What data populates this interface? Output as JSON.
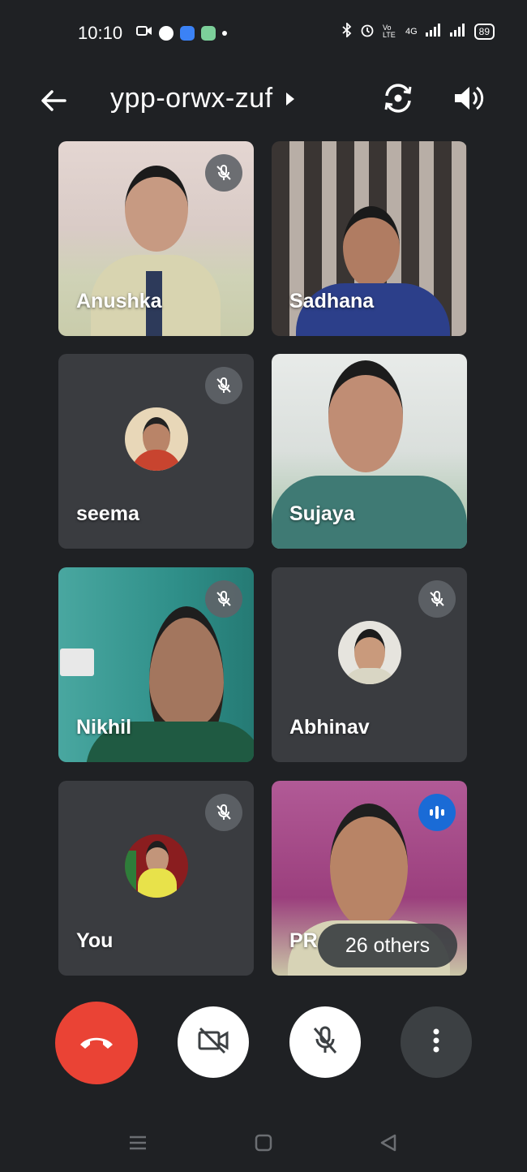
{
  "status_bar": {
    "time": "10:10",
    "network_label": "4G",
    "volte_label": "Vo LTE",
    "battery": "89",
    "left_icons": [
      "video-icon",
      "messenger-icon",
      "app-icon",
      "gallery-icon",
      "dot-icon"
    ],
    "right_icons": [
      "bluetooth-icon",
      "alarm-icon",
      "volte-icon",
      "signal-icon",
      "signal-icon",
      "battery-icon"
    ]
  },
  "top_bar": {
    "meeting_code": "ypp-orwx-zuf",
    "icons": [
      "back-arrow-icon",
      "caret-right-icon",
      "switch-camera-icon",
      "speaker-icon"
    ]
  },
  "participants": [
    {
      "name": "Anushka",
      "muted": true,
      "video": true
    },
    {
      "name": "Sadhana",
      "muted": false,
      "video": true
    },
    {
      "name": "seema",
      "muted": true,
      "video": false
    },
    {
      "name": "Sujaya",
      "muted": false,
      "video": true
    },
    {
      "name": "Nikhil",
      "muted": true,
      "video": true
    },
    {
      "name": "Abhinav",
      "muted": true,
      "video": false
    },
    {
      "name": "You",
      "muted": true,
      "video": false
    },
    {
      "name": "PR",
      "muted": false,
      "video": true,
      "speaking": true
    }
  ],
  "others": {
    "label": "26 others"
  },
  "controls": {
    "icons": [
      "end-call-icon",
      "camera-off-icon",
      "mic-off-icon",
      "more-vert-icon"
    ],
    "end_call_color": "#ea4335"
  },
  "nav_bar": {
    "icons": [
      "recents-icon",
      "home-icon",
      "back-icon"
    ]
  }
}
